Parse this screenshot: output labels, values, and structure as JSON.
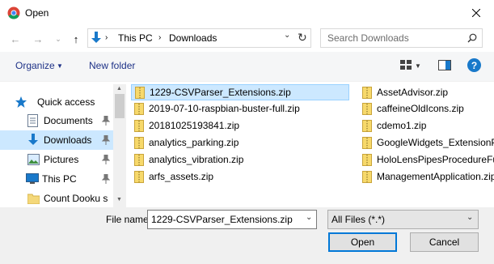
{
  "window": {
    "title": "Open",
    "close_label": "✕"
  },
  "nav": {
    "path": [
      "This PC",
      "Downloads"
    ],
    "search_placeholder": "Search Downloads"
  },
  "toolbar": {
    "organize": "Organize",
    "new_folder": "New folder",
    "help": "?"
  },
  "sidebar": {
    "items": [
      {
        "label": "Quick access",
        "icon": "star-icon",
        "pinned": false
      },
      {
        "label": "Documents",
        "icon": "documents-icon",
        "pinned": true
      },
      {
        "label": "Downloads",
        "icon": "downloads-icon",
        "pinned": true,
        "selected": true
      },
      {
        "label": "Pictures",
        "icon": "pictures-icon",
        "pinned": true
      },
      {
        "label": "This PC",
        "icon": "computer-icon",
        "pinned": true
      },
      {
        "label": "Count Dooku s",
        "icon": "folder-icon",
        "pinned": false
      }
    ]
  },
  "files": {
    "column1": [
      "1229-CSVParser_Extensions.zip",
      "2019-07-10-raspbian-buster-full.zip",
      "20181025193841.zip",
      "analytics_parking.zip",
      "analytics_vibration.zip",
      "arfs_assets.zip"
    ],
    "column2": [
      "AssetAdvisor.zip",
      "caffeineOldIcons.zip",
      "cdemo1.zip",
      "GoogleWidgets_ExtensionPa",
      "HoloLensPipesProcedureFu",
      "ManagementApplication.zip"
    ],
    "selected": "1229-CSVParser_Extensions.zip"
  },
  "footer": {
    "file_name_label": "File name:",
    "file_name_value": "1229-CSVParser_Extensions.zip",
    "file_type_value": "All Files (*.*)",
    "open_label": "Open",
    "cancel_label": "Cancel"
  },
  "colors": {
    "accent": "#0078d7",
    "selection": "#cce8ff",
    "link": "#1e3287",
    "help": "#1979ca"
  }
}
